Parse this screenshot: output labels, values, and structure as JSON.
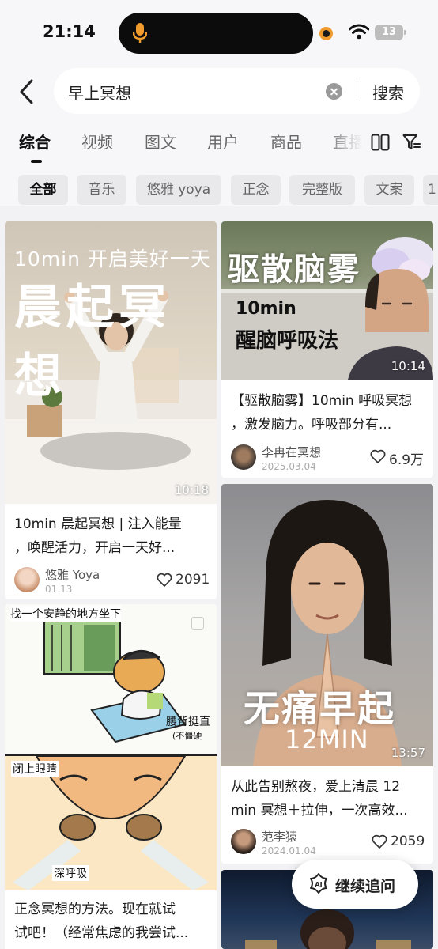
{
  "status_bar": {
    "time": "21:14",
    "battery": "13"
  },
  "search": {
    "query": "早上冥想",
    "submit_label": "搜索"
  },
  "tabs": [
    {
      "label": "综合"
    },
    {
      "label": "视频"
    },
    {
      "label": "图文"
    },
    {
      "label": "用户"
    },
    {
      "label": "商品"
    },
    {
      "label": "直播"
    }
  ],
  "chips": [
    {
      "label": "全部"
    },
    {
      "label": "音乐"
    },
    {
      "label": "悠雅 yoya"
    },
    {
      "label": "正念"
    },
    {
      "label": "完整版"
    },
    {
      "label": "文案"
    },
    {
      "label": "1"
    }
  ],
  "cards": {
    "c1": {
      "overlay_small": "10min 开启美好一天",
      "overlay_big": "晨起冥想",
      "duration": "10:18",
      "title_line1": "10min 晨起冥想 | 注入能量",
      "title_line2": "，唤醒活力，开启一天好...",
      "author": "悠雅 Yoya",
      "date": "01.13",
      "likes": "2091"
    },
    "c2": {
      "overlay_big": "驱散脑雾",
      "overlay_small_1": "10min",
      "overlay_small_2": "醒脑呼吸法",
      "duration": "10:14",
      "title_line1": "【驱散脑雾】10min 呼吸冥想",
      "title_line2": "，激发脑力。呼吸部分有...",
      "author": "李冉在冥想",
      "date": "2025.03.04",
      "likes": "6.9万"
    },
    "c3": {
      "panel_top": "找一个安静的地方坐下",
      "panel_label_1": "腰背挺直",
      "panel_label_2": "(不僵硬",
      "panel_bottom_1": "闭上眼睛",
      "panel_bottom_2": "深呼吸",
      "title_line1": "正念冥想的方法。现在就试",
      "title_line2": "试吧！（经常焦虑的我尝试..."
    },
    "c4": {
      "overlay_big": "无痛早起",
      "overlay_small": "12MIN",
      "duration": "13:57",
      "title_line1": "从此告别熬夜，爱上清晨 12",
      "title_line2": "min 冥想＋拉伸，一次高效...",
      "author": "范李猿",
      "date": "2024.01.04",
      "likes": "2059"
    }
  },
  "ai_button": {
    "label": "继续追问",
    "icon_text": "AI"
  },
  "colors": {
    "bg": "#f2f2f4",
    "card": "#ffffff",
    "accent_orange": "#f19a2d"
  }
}
